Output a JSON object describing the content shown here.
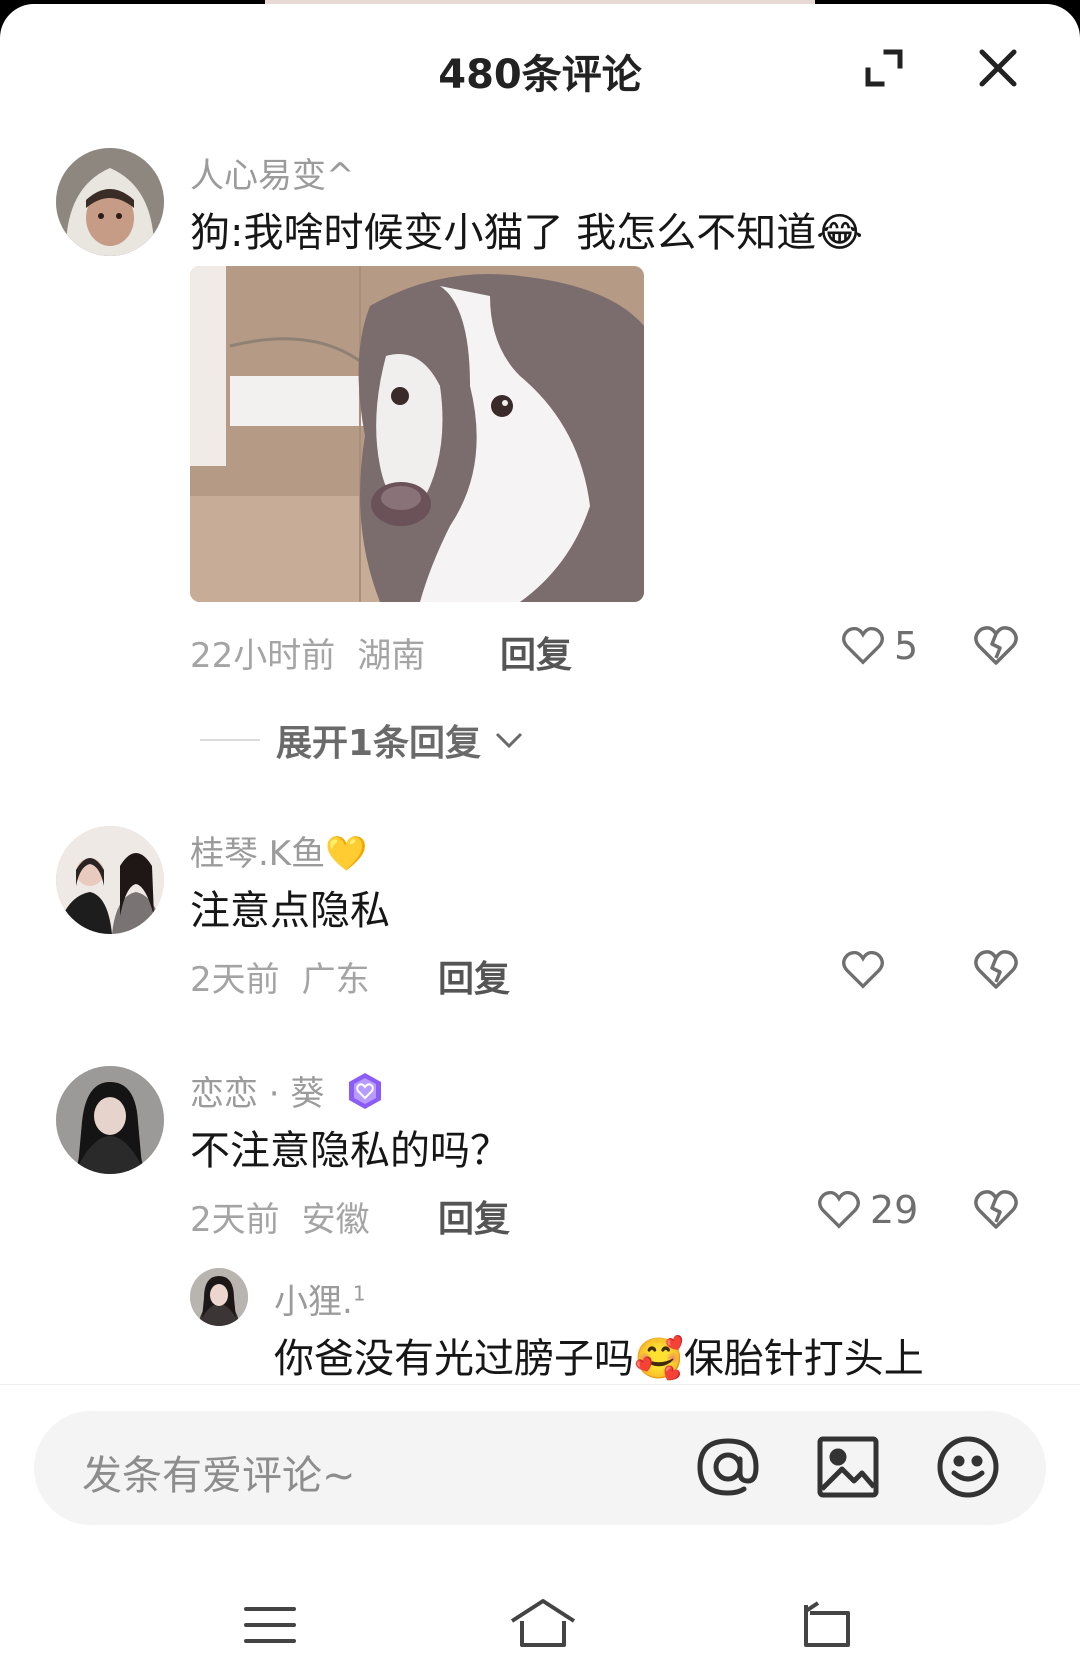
{
  "header": {
    "title": "480条评论"
  },
  "comments": [
    {
      "username": "人心易变^",
      "text": "狗:我啥时候变小猫了  我怎么不知道",
      "emoji": "😂",
      "time": "22小时前",
      "location": "湖南",
      "reply_label": "回复",
      "likes": "5",
      "expand_label": "展开1条回复"
    },
    {
      "username": "桂琴.K鱼",
      "username_emoji": "💛",
      "text": "注意点隐私",
      "time": "2天前",
      "location": "广东",
      "reply_label": "回复",
      "likes": ""
    },
    {
      "username": "恋恋 · 葵",
      "text": "不注意隐私的吗？",
      "time": "2天前",
      "location": "安徽",
      "reply_label": "回复",
      "likes": "29"
    }
  ],
  "sub_reply": {
    "username": "小狸.",
    "username_sup": "1",
    "text_before": "你爸没有光过膀子吗",
    "emoji": "🥰",
    "text_after": "保胎针打头上"
  },
  "input": {
    "placeholder": "发条有爱评论~"
  },
  "icons": [
    "expand-icon",
    "close-icon",
    "heart-icon",
    "dislike-icon",
    "at-icon",
    "image-icon",
    "emoji-icon",
    "menu-icon",
    "home-icon",
    "back-icon"
  ],
  "colors": {
    "badge": "#8b5cf6",
    "text": "#161616",
    "meta": "#a4a4a4"
  }
}
